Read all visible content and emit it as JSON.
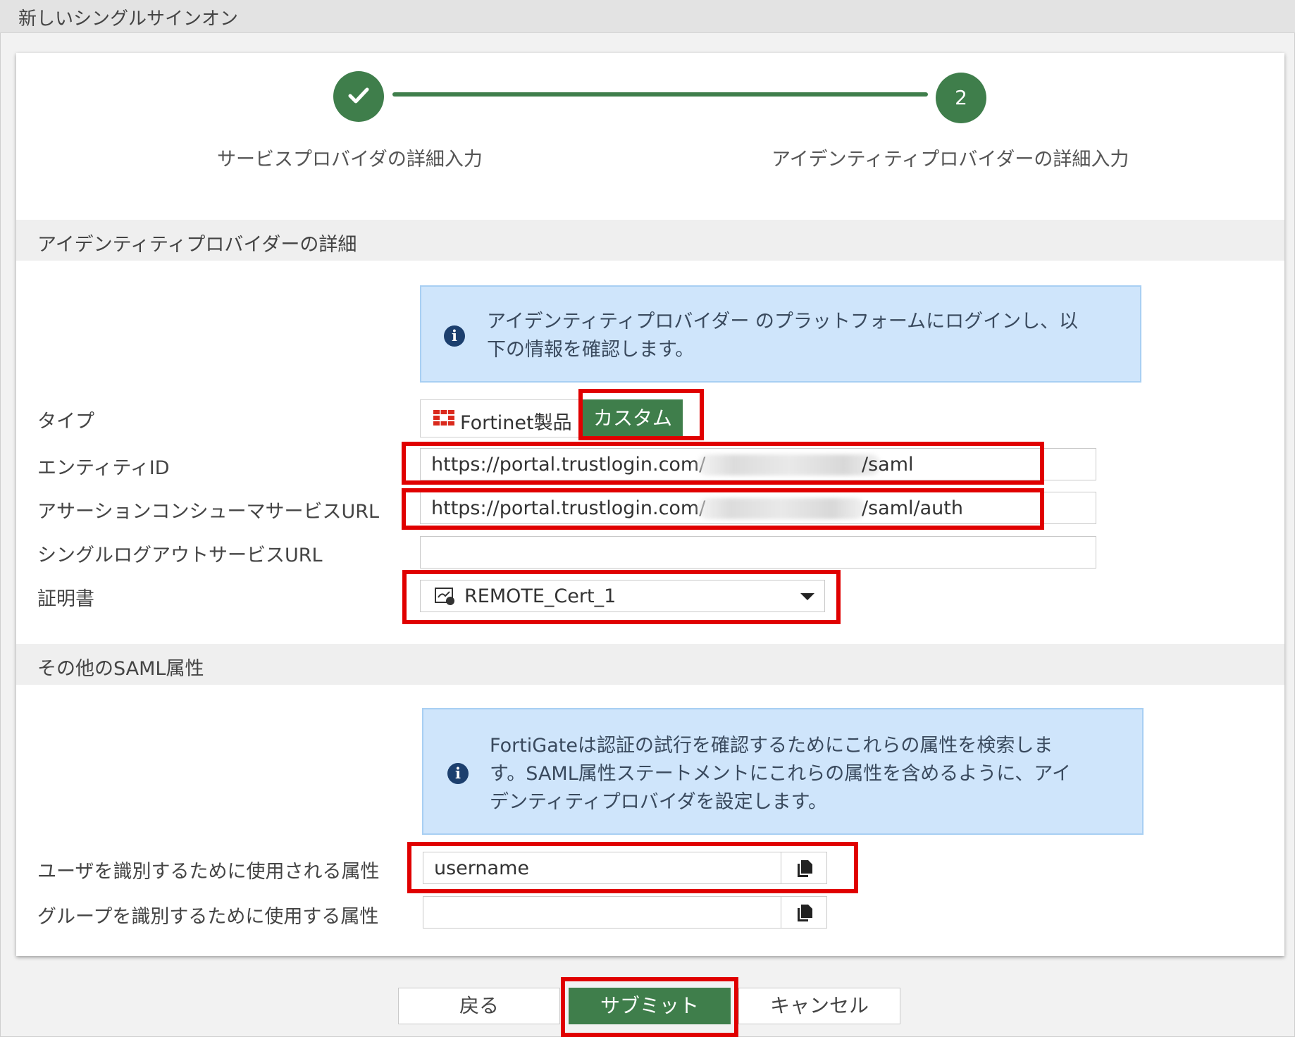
{
  "window": {
    "title": "新しいシングルサインオン"
  },
  "stepper": {
    "steps": [
      {
        "label": "サービスプロバイダの詳細入力",
        "state": "done"
      },
      {
        "number": "2",
        "label": "アイデンティティプロバイダーの詳細入力",
        "state": "current"
      }
    ],
    "accent_color": "#3f7e4b"
  },
  "idp_section": {
    "title": "アイデンティティプロバイダーの詳細",
    "info_text": "アイデンティティプロバイダー のプラットフォームにログインし、以\n下の情報を確認します。",
    "type": {
      "label": "タイプ",
      "options": [
        "Fortinet製品",
        "カスタム"
      ],
      "selected": "カスタム"
    },
    "entity_id": {
      "label": "エンティティID",
      "value_prefix": "https://portal.trustlogin.com/",
      "value_suffix": "/saml"
    },
    "acs_url": {
      "label": "アサーションコンシューマサービスURL",
      "value_prefix": "https://portal.trustlogin.com/",
      "value_suffix": "/saml/auth"
    },
    "slo_url": {
      "label": "シングルログアウトサービスURL",
      "value": ""
    },
    "certificate": {
      "label": "証明書",
      "value": "REMOTE_Cert_1"
    }
  },
  "saml_section": {
    "title": "その他のSAML属性",
    "info_text": "FortiGateは認証の試行を確認するためにこれらの属性を検索しま\nす。SAML属性ステートメントにこれらの属性を含めるように、アイ\nデンティティプロバイダを設定します。",
    "user_attr": {
      "label": "ユーザを識別するために使用される属性",
      "value": "username"
    },
    "group_attr": {
      "label": "グループを識別するために使用する属性",
      "value": ""
    }
  },
  "buttons": {
    "back": "戻る",
    "submit": "サブミット",
    "cancel": "キャンセル"
  },
  "highlight_color": "#e00000"
}
